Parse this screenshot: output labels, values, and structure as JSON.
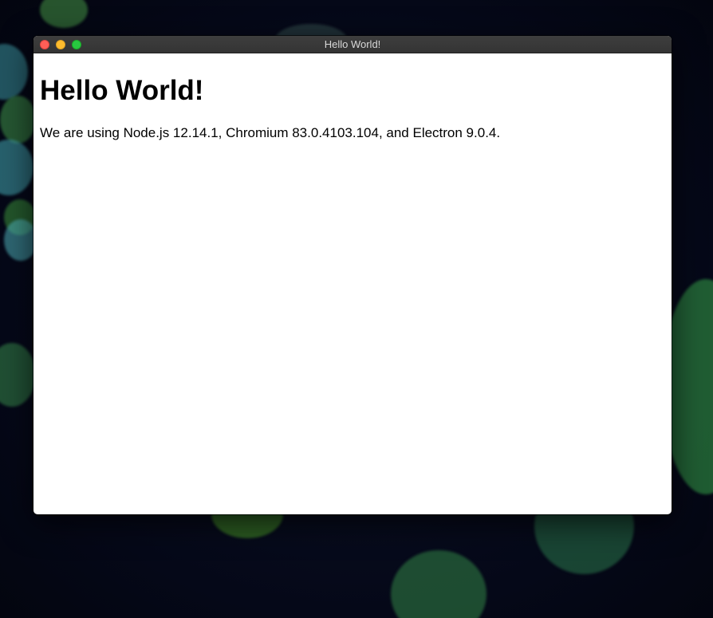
{
  "window": {
    "title": "Hello World!"
  },
  "content": {
    "heading": "Hello World!",
    "body_text": "We are using Node.js 12.14.1, Chromium 83.0.4103.104, and Electron 9.0.4."
  },
  "controls": {
    "close_color": "#fe5f57",
    "minimize_color": "#febc2e",
    "zoom_color": "#28c840"
  }
}
